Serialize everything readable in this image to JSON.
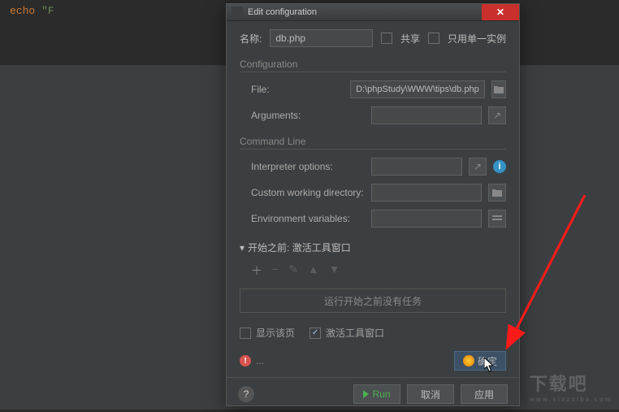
{
  "editor": {
    "code_echo": "echo",
    "code_str": "\"F"
  },
  "dialog": {
    "title": "Edit configuration",
    "name_label": "名称:",
    "name_value": "db.php",
    "share_label": "共享",
    "single_instance_label": "只用单一实例",
    "config_section": "Configuration",
    "file_label": "File:",
    "file_value": "D:\\phpStudy\\WWW\\tips\\db.php",
    "arguments_label": "Arguments:",
    "arguments_value": "",
    "cmdline_section": "Command Line",
    "interpreter_label": "Interpreter options:",
    "interpreter_value": "",
    "workdir_label": "Custom working directory:",
    "workdir_value": "",
    "envvars_label": "Environment variables:",
    "envvars_value": "",
    "before_launch_label": "开始之前: 激活工具窗口",
    "no_tasks_text": "运行开始之前没有任务",
    "show_this_page_label": "显示该页",
    "activate_tool_label": "激活工具窗口",
    "warning_text": "...",
    "ok_button": "确定",
    "run_button": "Run",
    "cancel_button": "取消",
    "apply_button": "应用"
  },
  "watermark": {
    "main": "下载吧",
    "sub": "www.xiazaiba.com"
  }
}
